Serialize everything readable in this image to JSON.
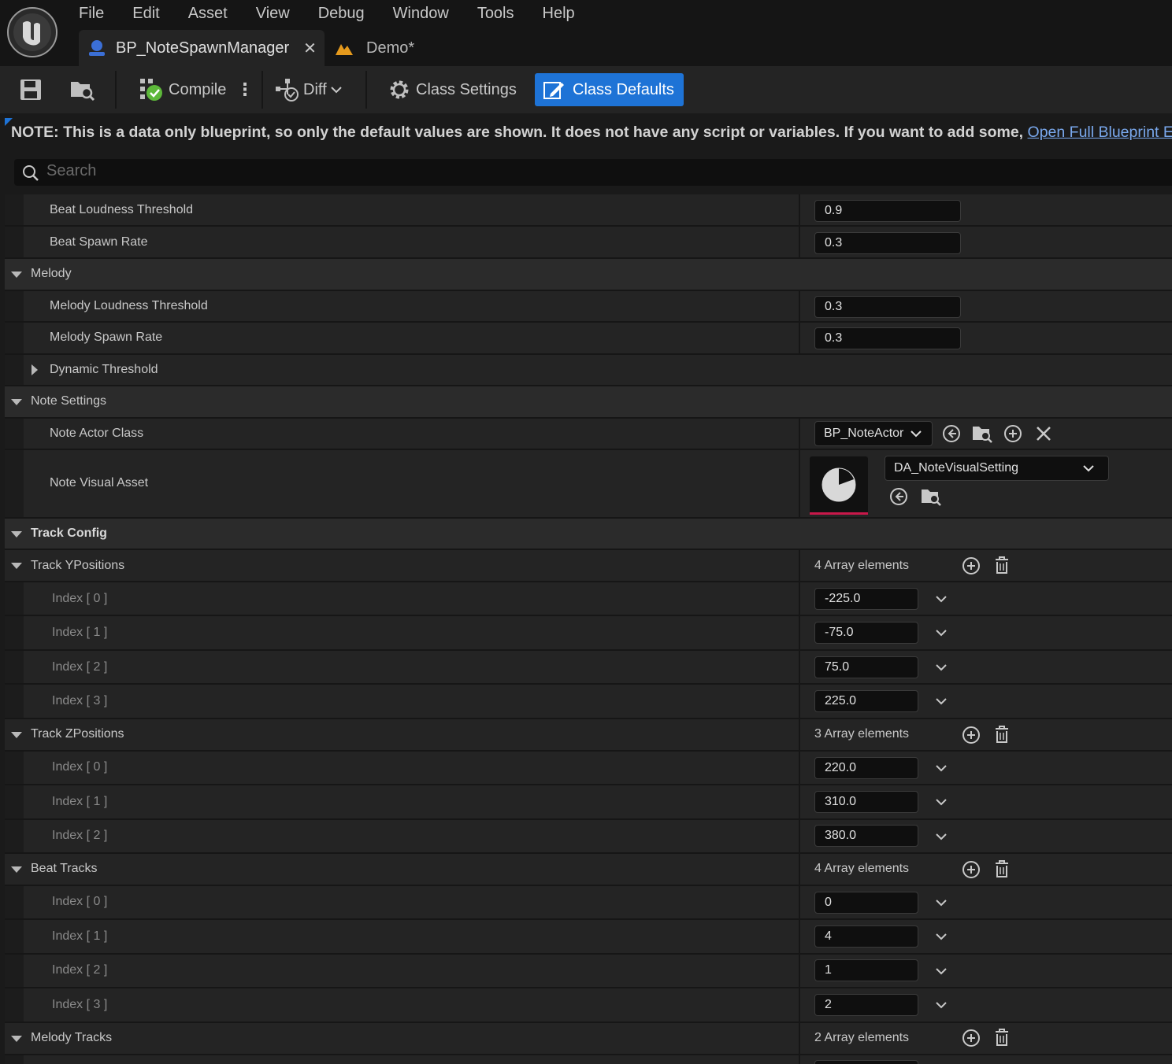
{
  "menu": [
    "File",
    "Edit",
    "Asset",
    "View",
    "Debug",
    "Window",
    "Tools",
    "Help"
  ],
  "tabs": {
    "active": "BP_NoteSpawnManager",
    "inactive": "Demo*"
  },
  "toolbar": {
    "compile": "Compile",
    "diff": "Diff",
    "class_settings": "Class Settings",
    "class_defaults": "Class Defaults"
  },
  "note": {
    "text": "NOTE: This is a data only blueprint, so only the default values are shown.  It does not have any script or variables.  If you want to add some,",
    "link": "Open Full Blueprint Editor"
  },
  "search": {
    "placeholder": "Search"
  },
  "properties": {
    "beat_loudness_threshold": {
      "label": "Beat Loudness Threshold",
      "value": "0.9"
    },
    "beat_spawn_rate": {
      "label": "Beat Spawn Rate",
      "value": "0.3"
    },
    "melody": "Melody",
    "melody_loudness_threshold": {
      "label": "Melody Loudness Threshold",
      "value": "0.3"
    },
    "melody_spawn_rate": {
      "label": "Melody Spawn Rate",
      "value": "0.3"
    },
    "dynamic_threshold": "Dynamic Threshold",
    "note_settings": "Note Settings",
    "note_actor_class": {
      "label": "Note Actor Class",
      "value": "BP_NoteActor"
    },
    "note_visual_asset": {
      "label": "Note Visual Asset",
      "value": "DA_NoteVisualSetting"
    },
    "track_config": "Track Config",
    "track_ypositions": {
      "label": "Track YPositions",
      "count": "4 Array elements",
      "items": [
        {
          "index": "Index [ 0 ]",
          "value": "-225.0"
        },
        {
          "index": "Index [ 1 ]",
          "value": "-75.0"
        },
        {
          "index": "Index [ 2 ]",
          "value": "75.0"
        },
        {
          "index": "Index [ 3 ]",
          "value": "225.0"
        }
      ]
    },
    "track_zpositions": {
      "label": "Track ZPositions",
      "count": "3 Array elements",
      "items": [
        {
          "index": "Index [ 0 ]",
          "value": "220.0"
        },
        {
          "index": "Index [ 1 ]",
          "value": "310.0"
        },
        {
          "index": "Index [ 2 ]",
          "value": "380.0"
        }
      ]
    },
    "beat_tracks": {
      "label": "Beat Tracks",
      "count": "4 Array elements",
      "items": [
        {
          "index": "Index [ 0 ]",
          "value": "0"
        },
        {
          "index": "Index [ 1 ]",
          "value": "4"
        },
        {
          "index": "Index [ 2 ]",
          "value": "1"
        },
        {
          "index": "Index [ 3 ]",
          "value": "2"
        }
      ]
    },
    "melody_tracks": {
      "label": "Melody Tracks",
      "count": "2 Array elements"
    }
  },
  "colors": {
    "accent": "#1e73d6",
    "link": "#7aa9ee",
    "thumb_bar": "#c8184a"
  }
}
